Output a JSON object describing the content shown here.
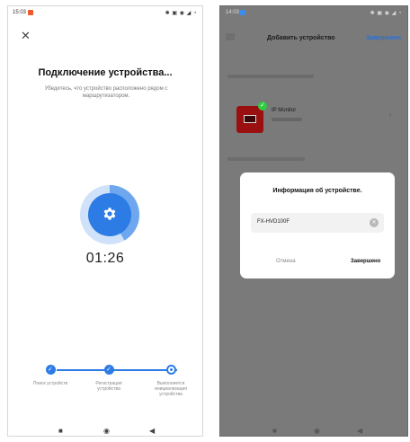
{
  "left_screen": {
    "status_time": "15:03",
    "status_icons": "✱ ▣ ◉ ◢ ◔",
    "title": "Подключение устройства...",
    "hint": "Убедитесь, что устройство расположено рядом с маршрутизатором.",
    "timer": "01:26",
    "steps": [
      {
        "label": "Поиск устройств",
        "state": "done"
      },
      {
        "label": "Регистрация устройства",
        "state": "done"
      },
      {
        "label": "Выполняется инициализация устройства",
        "state": "current"
      }
    ],
    "accent_color": "#2d7be5",
    "icons": {
      "close": "close-icon",
      "progress": "gear-icon"
    }
  },
  "right_screen": {
    "status_time": "14:03",
    "status_icons": "✱ ▣ ◉ ◢ ◔",
    "title": "Добавить устройство",
    "done_label": "Завершено",
    "device": {
      "name": "IP Monitor",
      "check_icon": "✓"
    },
    "dialog": {
      "title": "Информация об устройстве.",
      "input_value": "FX-HVD100F",
      "cancel_label": "Отмена",
      "confirm_label": "Завершено"
    },
    "accent_color": "#2d6fce"
  },
  "nav": {
    "home": "■",
    "circle": "◉",
    "back": "◀"
  }
}
